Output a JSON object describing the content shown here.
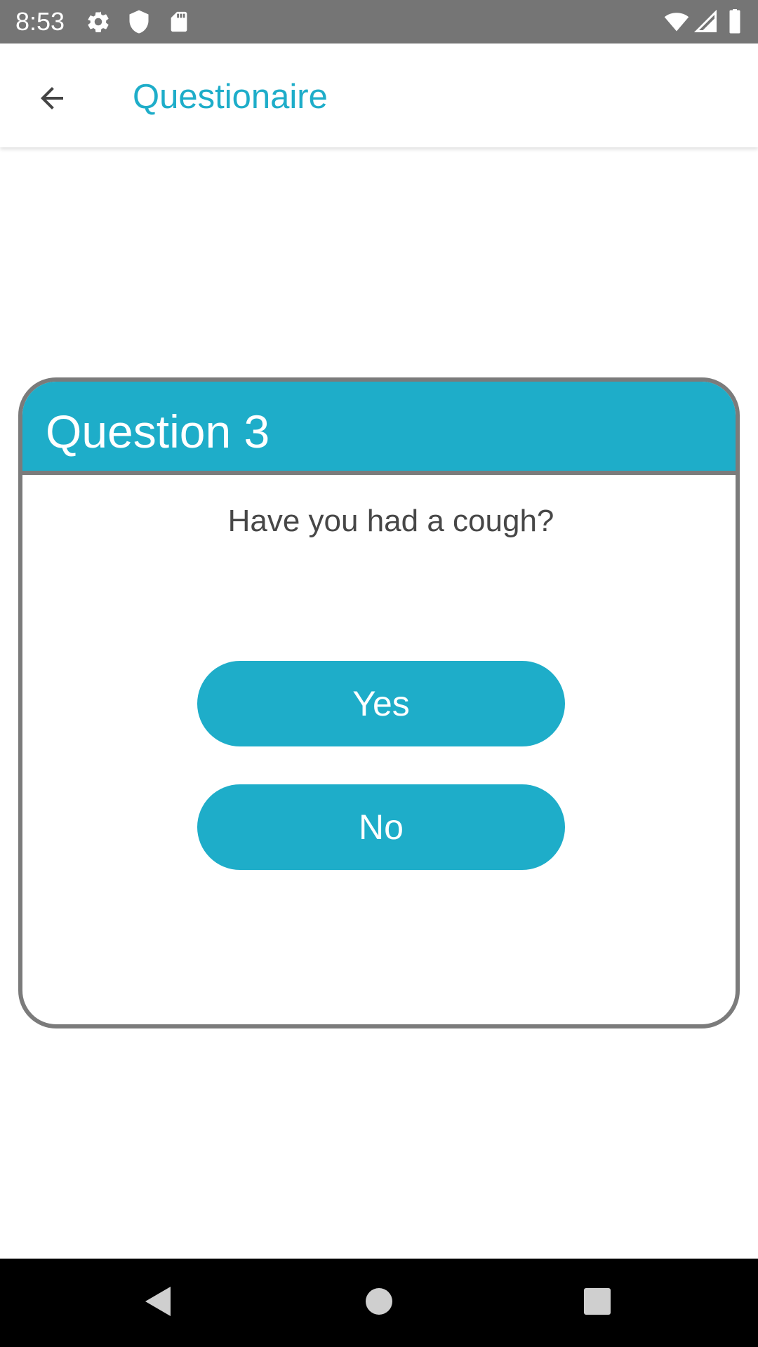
{
  "status_bar": {
    "time": "8:53",
    "left_icons": [
      "gear-icon",
      "shield-icon",
      "sd-card-icon"
    ],
    "right_icons": [
      "wifi-icon",
      "cell-signal-icon",
      "battery-icon"
    ],
    "background": "#757575"
  },
  "app_bar": {
    "title": "Questionaire",
    "back_icon": "arrow-back-icon",
    "title_color": "#1eadc9"
  },
  "card": {
    "title": "Question 3",
    "question": "Have you had a cough?",
    "answers": {
      "yes": "Yes",
      "no": "No"
    },
    "accent_color": "#1eadc9",
    "border_color": "#7b7b7b"
  },
  "nav_bar": {
    "buttons": [
      "back-triangle-icon",
      "home-circle-icon",
      "recents-square-icon"
    ]
  }
}
